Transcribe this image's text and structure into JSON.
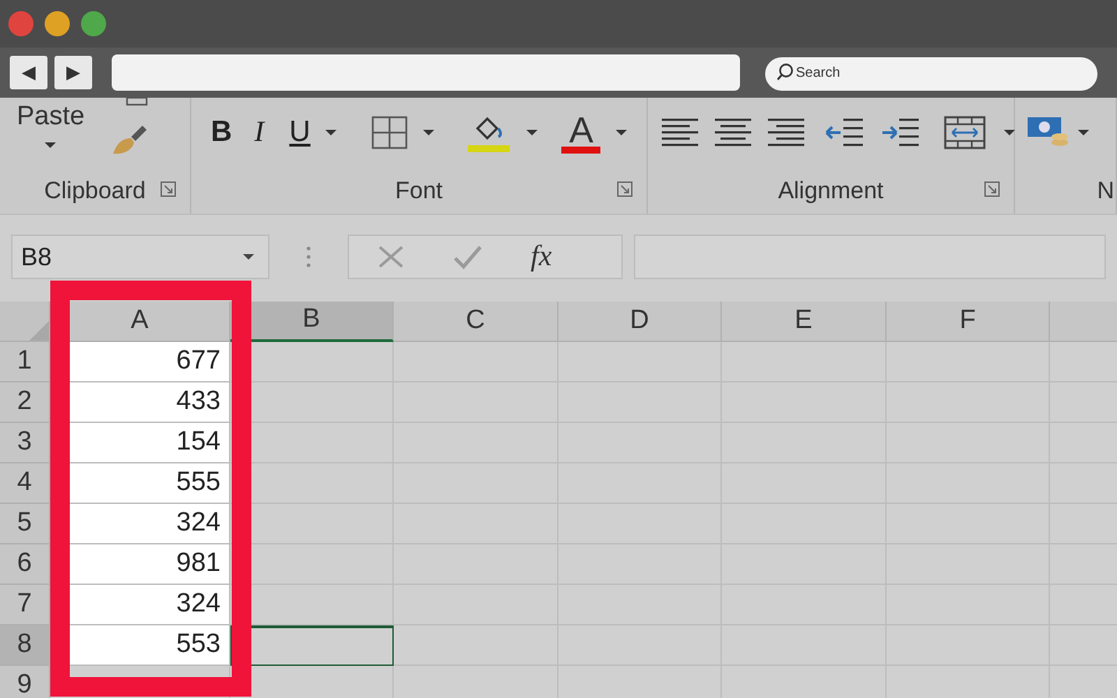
{
  "title_bar": {
    "window_controls": [
      {
        "color": "#e0443e"
      },
      {
        "color": "#dea123"
      },
      {
        "color": "#4fa84a"
      }
    ]
  },
  "toolbar": {
    "back": "◀",
    "forward": "▶",
    "search": {
      "placeholder": "Search"
    }
  },
  "ribbon": {
    "groups": [
      {
        "kind": "clipboard",
        "label": "Clipboard",
        "paste": "Paste"
      },
      {
        "kind": "font",
        "label": "Font",
        "bold": "B",
        "italic": "I",
        "underline": "U",
        "font_color": "A"
      },
      {
        "kind": "alignment",
        "label": "Alignment"
      },
      {
        "kind": "number",
        "label": "N"
      }
    ]
  },
  "formula_bar": {
    "name_box": "B8",
    "function": "fx"
  },
  "sheet": {
    "columns": [
      {
        "label": "A",
        "selected": false,
        "highlighted": true
      },
      {
        "label": "B",
        "selected": true,
        "highlighted": false
      },
      {
        "label": "C",
        "selected": false,
        "highlighted": false
      },
      {
        "label": "D",
        "selected": false,
        "highlighted": false
      },
      {
        "label": "E",
        "selected": false,
        "highlighted": false
      },
      {
        "label": "F",
        "selected": false,
        "highlighted": false
      }
    ],
    "rows": [
      {
        "header": "1",
        "cells": [
          "677"
        ],
        "selected": false
      },
      {
        "header": "2",
        "cells": [
          "433"
        ],
        "selected": false
      },
      {
        "header": "3",
        "cells": [
          "154"
        ],
        "selected": false
      },
      {
        "header": "4",
        "cells": [
          "555"
        ],
        "selected": false
      },
      {
        "header": "5",
        "cells": [
          "324"
        ],
        "selected": false
      },
      {
        "header": "6",
        "cells": [
          "981"
        ],
        "selected": false
      },
      {
        "header": "7",
        "cells": [
          "324"
        ],
        "selected": false
      },
      {
        "header": "8",
        "cells": [
          "553"
        ],
        "selected": true
      },
      {
        "header": "9",
        "cells": [],
        "selected": false
      }
    ]
  }
}
